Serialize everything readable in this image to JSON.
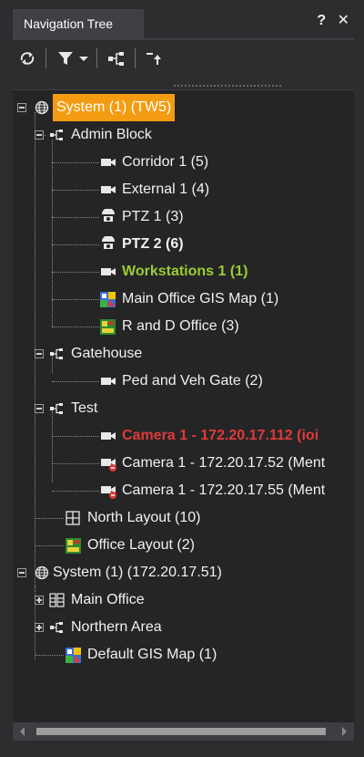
{
  "window": {
    "title": "Navigation Tree",
    "header_buttons": "? ✕"
  },
  "toolbar": {
    "refresh_icon": "refresh-icon",
    "filter_icon": "filter-icon",
    "dropdown_icon": "chevron-down-icon",
    "group_icon": "group-icon",
    "collapse_icon": "collapse-up-icon"
  },
  "colors": {
    "selected_bg": "#f39c12",
    "bold_green": "#9acd32",
    "alarm_red": "#e03a3a"
  },
  "tree": {
    "items": [
      {
        "label": "System (1) (TW5)",
        "icon": "globe-icon",
        "style": "selected"
      },
      {
        "label": "Admin Block",
        "icon": "group-icon",
        "style": "normal"
      },
      {
        "label": "Corridor 1 (5)",
        "icon": "camera-icon",
        "style": "normal"
      },
      {
        "label": "External 1 (4)",
        "icon": "camera-icon",
        "style": "normal"
      },
      {
        "label": "PTZ 1 (3)",
        "icon": "ptz-camera-icon",
        "style": "normal"
      },
      {
        "label": "PTZ 2 (6)",
        "icon": "ptz-camera-icon",
        "style": "bold"
      },
      {
        "label": "Workstations 1 (1)",
        "icon": "camera-icon",
        "style": "green"
      },
      {
        "label": "Main Office GIS Map (1)",
        "icon": "gis-map-icon",
        "style": "normal"
      },
      {
        "label": "R and D Office (3)",
        "icon": "floor-plan-icon",
        "style": "normal"
      },
      {
        "label": "Gatehouse",
        "icon": "group-icon",
        "style": "normal"
      },
      {
        "label": "Ped and Veh Gate (2)",
        "icon": "camera-icon",
        "style": "normal"
      },
      {
        "label": "Test",
        "icon": "group-icon",
        "style": "normal"
      },
      {
        "label": "Camera 1 - 172.20.17.112 (ioi",
        "icon": "camera-icon",
        "style": "red"
      },
      {
        "label": "Camera 1 - 172.20.17.52 (Ment",
        "icon": "camera-offline-icon",
        "style": "normal"
      },
      {
        "label": "Camera 1 - 172.20.17.55 (Ment",
        "icon": "camera-offline-icon",
        "style": "normal"
      },
      {
        "label": "North Layout (10)",
        "icon": "grid-layout-icon",
        "style": "normal"
      },
      {
        "label": "Office Layout (2)",
        "icon": "floor-plan-icon",
        "style": "normal"
      },
      {
        "label": "System (1) (172.20.17.51)",
        "icon": "globe-icon",
        "style": "normal"
      },
      {
        "label": "Main Office",
        "icon": "layout-grid-icon",
        "style": "normal"
      },
      {
        "label": "Northern Area",
        "icon": "group-icon",
        "style": "normal"
      },
      {
        "label": "Default GIS Map (1)",
        "icon": "gis-map-icon",
        "style": "normal"
      }
    ]
  }
}
